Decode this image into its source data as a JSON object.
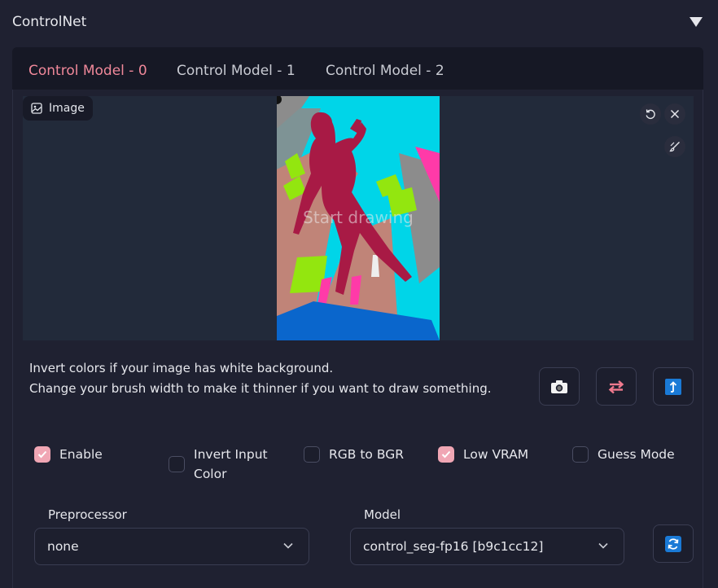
{
  "panel": {
    "title": "ControlNet"
  },
  "tabs": [
    {
      "label": "Control Model - 0",
      "active": true
    },
    {
      "label": "Control Model - 1",
      "active": false
    },
    {
      "label": "Control Model - 2",
      "active": false
    }
  ],
  "canvas": {
    "image_label": "Image",
    "placeholder": "Start drawing"
  },
  "info": {
    "line1": "Invert colors if your image has white background.",
    "line2": "Change your brush width to make it thinner if you want to draw something."
  },
  "options": [
    {
      "label": "Enable",
      "checked": true
    },
    {
      "label": "Invert Input Color",
      "checked": false
    },
    {
      "label": "RGB to BGR",
      "checked": false
    },
    {
      "label": "Low VRAM",
      "checked": true
    },
    {
      "label": "Guess Mode",
      "checked": false
    }
  ],
  "preprocessor": {
    "label": "Preprocessor",
    "value": "none"
  },
  "model": {
    "label": "Model",
    "value": "control_seg-fp16 [b9c1cc12]"
  },
  "icons": {
    "collapse": "triangle-down-icon",
    "image": "image-icon",
    "undo": "undo-icon",
    "close": "close-icon",
    "brush": "brush-icon",
    "camera": "camera-icon",
    "swap": "swap-arrows-icon",
    "resize": "upload-arrow-icon",
    "refresh": "refresh-icon"
  },
  "colors": {
    "accent": "#f0889a",
    "checkbox_on": "#f0a6b4",
    "background": "#1f2131",
    "tab_bar": "#161825",
    "canvas": "#222a3a"
  }
}
